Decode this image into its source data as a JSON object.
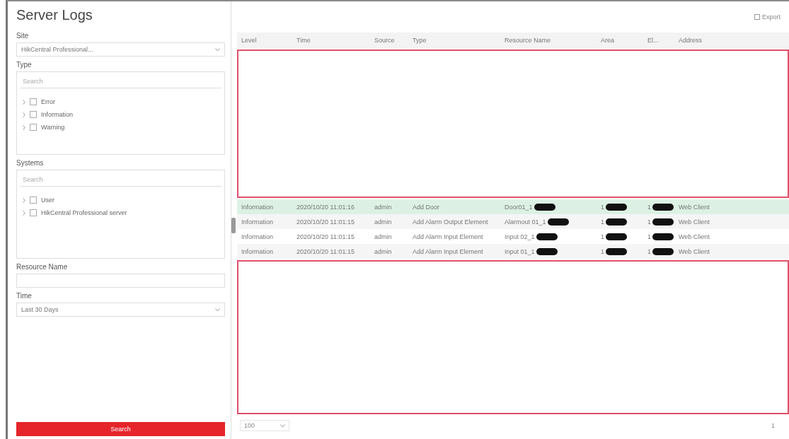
{
  "title": "Server Logs",
  "filters": {
    "site": {
      "label": "Site",
      "value": "HikCentral Professional..."
    },
    "type": {
      "label": "Type",
      "placeholder": "Search",
      "items": [
        {
          "label": "Error",
          "checked": false
        },
        {
          "label": "Information",
          "checked": false
        },
        {
          "label": "Warning",
          "checked": false
        }
      ]
    },
    "systems": {
      "label": "Systems",
      "placeholder": "Search",
      "items": [
        {
          "label": "User",
          "checked": false
        },
        {
          "label": "HikCentral Professional server",
          "checked": false
        }
      ]
    },
    "resource_name": {
      "label": "Resource Name"
    },
    "time": {
      "label": "Time",
      "value": "Last 30 Days"
    },
    "search_button": "Search"
  },
  "toolbar": {
    "export": "Export"
  },
  "table": {
    "columns": [
      "Level",
      "Time",
      "Source",
      "Type",
      "Resource Name",
      "Area",
      "El...",
      "Address"
    ],
    "rows": [
      {
        "selected": true,
        "cells": [
          "Information",
          "2020/10/20 11:01:16",
          "admin",
          "Add Door",
          "Door01_1",
          "1",
          "1"
        ],
        "address_tail": "Web Client"
      },
      {
        "selected": false,
        "cells": [
          "Information",
          "2020/10/20 11:01:15",
          "admin",
          "Add Alarm Output Element",
          "Alarmout 01_1",
          "1",
          "1"
        ],
        "address_tail": "Web Client"
      },
      {
        "selected": false,
        "cells": [
          "Information",
          "2020/10/20 11:01:15",
          "admin",
          "Add Alarm Input Element",
          "Input 02_1",
          "1",
          "1"
        ],
        "address_tail": "Web Client"
      },
      {
        "selected": false,
        "cells": [
          "Information",
          "2020/10/20 11:01:15",
          "admin",
          "Add Alarm Input Element",
          "Input 01_1",
          "1",
          "1"
        ],
        "address_tail": "Web Client"
      }
    ]
  },
  "pagination": {
    "page_size": "100",
    "page": "1"
  }
}
